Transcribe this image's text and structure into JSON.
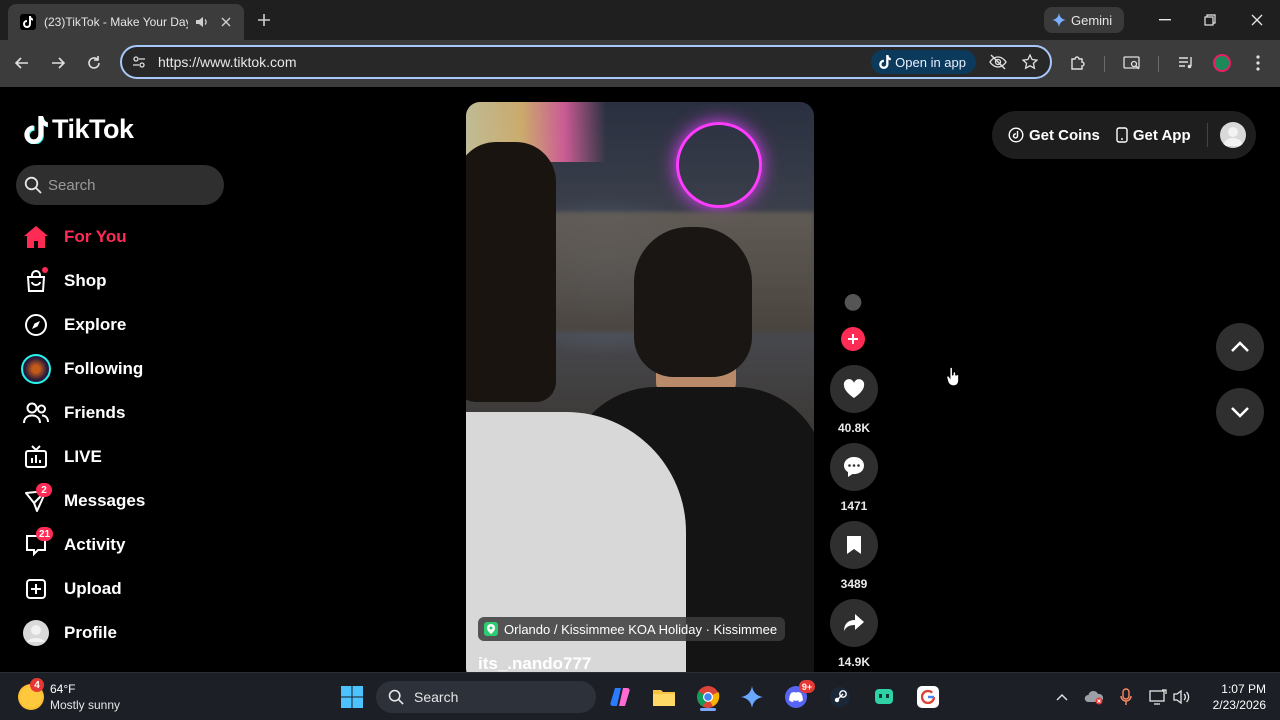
{
  "browser": {
    "tab_title": "(23)TikTok - Make Your Day",
    "url": "https://www.tiktok.com",
    "open_in_app": "Open in app",
    "gemini_label": "Gemini"
  },
  "tiktok": {
    "logo_text": "TikTok",
    "search_placeholder": "Search",
    "nav": [
      {
        "label": "For You",
        "icon": "home-icon",
        "active": true
      },
      {
        "label": "Shop",
        "icon": "shop-bag-icon",
        "dot": true
      },
      {
        "label": "Explore",
        "icon": "compass-icon"
      },
      {
        "label": "Following",
        "icon": "following-avatar-icon"
      },
      {
        "label": "Friends",
        "icon": "friends-icon"
      },
      {
        "label": "LIVE",
        "icon": "live-tv-icon"
      },
      {
        "label": "Messages",
        "icon": "send-icon",
        "badge": "2"
      },
      {
        "label": "Activity",
        "icon": "activity-chat-icon",
        "badge": "21"
      },
      {
        "label": "Upload",
        "icon": "plus-square-icon"
      },
      {
        "label": "Profile",
        "icon": "profile-avatar-icon"
      }
    ],
    "video": {
      "location": "Orlando / Kissimmee KOA Holiday · Kissimmee",
      "username": "its_.nando777"
    },
    "actions": {
      "likes": "40.8K",
      "comments": "1471",
      "saves": "3489",
      "shares": "14.9K"
    },
    "top_right": {
      "get_coins": "Get Coins",
      "get_app": "Get App"
    }
  },
  "taskbar": {
    "weather_temp": "64°F",
    "weather_desc": "Mostly sunny",
    "weather_badge": "4",
    "search_label": "Search",
    "discord_badge": "9+",
    "time": "1:07 PM",
    "date": "2/23/2026"
  }
}
